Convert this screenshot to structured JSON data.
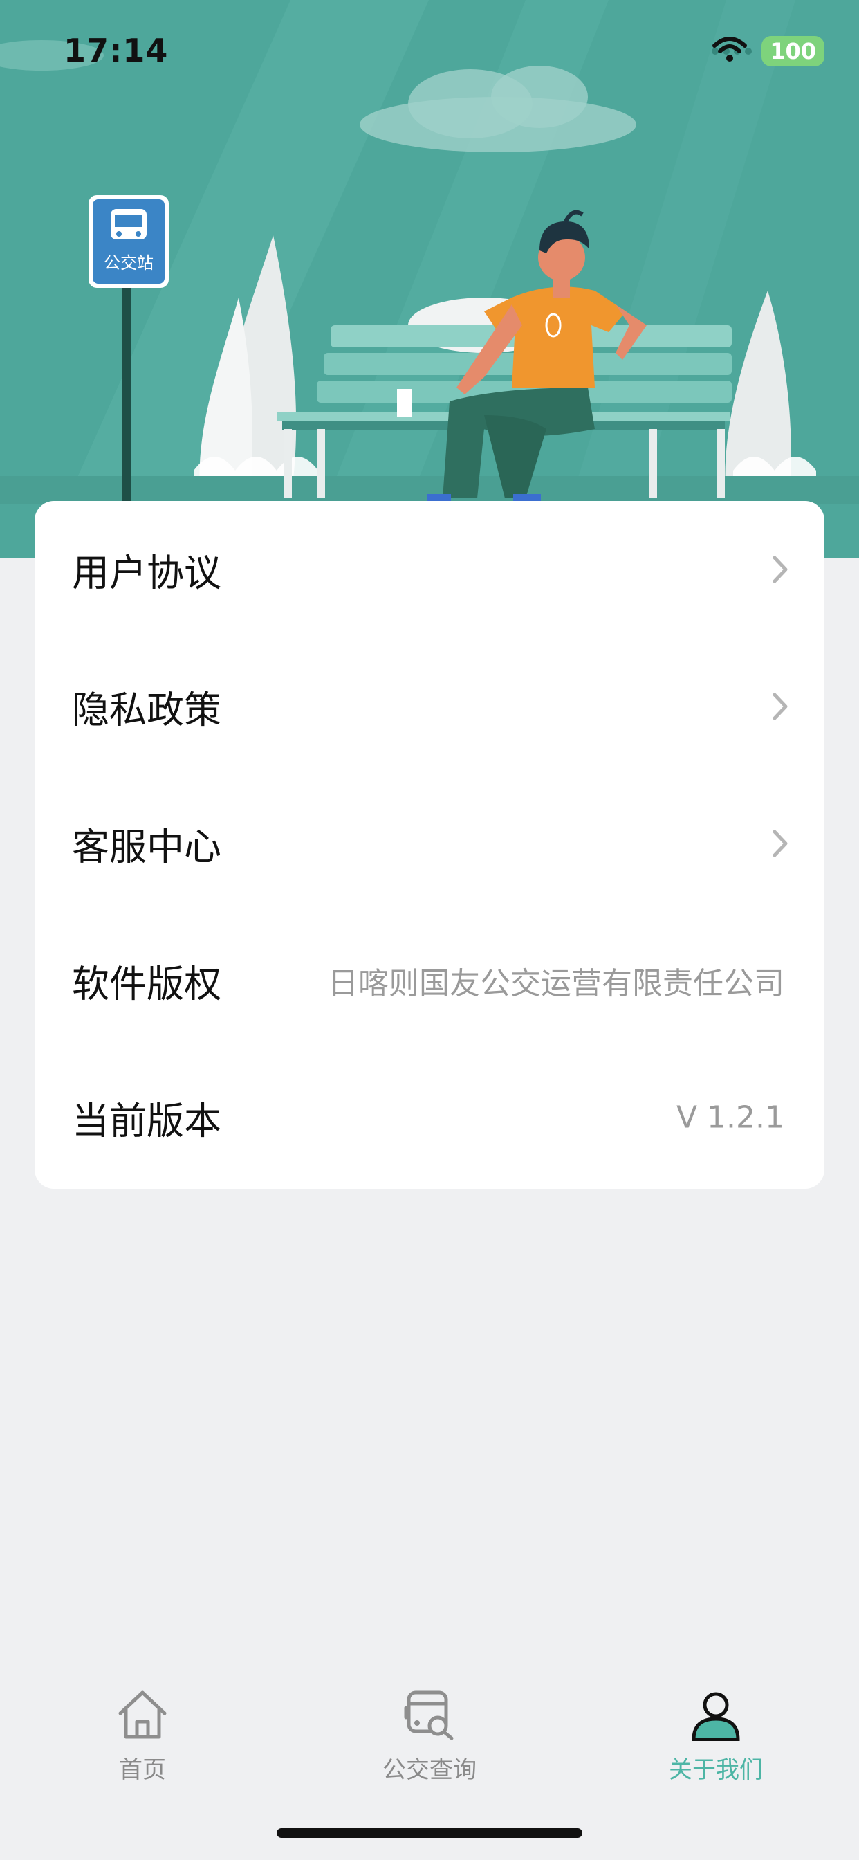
{
  "status_bar": {
    "time": "17:14",
    "battery": "100"
  },
  "hero": {
    "bus_sign_label": "公交站"
  },
  "menu": {
    "items": [
      {
        "label": "用户协议",
        "has_chevron": true
      },
      {
        "label": "隐私政策",
        "has_chevron": true
      },
      {
        "label": "客服中心",
        "has_chevron": true
      },
      {
        "label": "软件版权",
        "value": "日喀则国友公交运营有限责任公司"
      },
      {
        "label": "当前版本",
        "value": "V 1.2.1"
      }
    ]
  },
  "tabbar": {
    "tabs": [
      {
        "label": "首页",
        "icon": "home-icon",
        "active": false
      },
      {
        "label": "公交查询",
        "icon": "bus-search-icon",
        "active": false
      },
      {
        "label": "关于我们",
        "icon": "person-icon",
        "active": true
      }
    ]
  },
  "colors": {
    "accent": "#4db5a5",
    "hero_bg": "#4ea79b",
    "page_bg": "#eff0f2"
  }
}
